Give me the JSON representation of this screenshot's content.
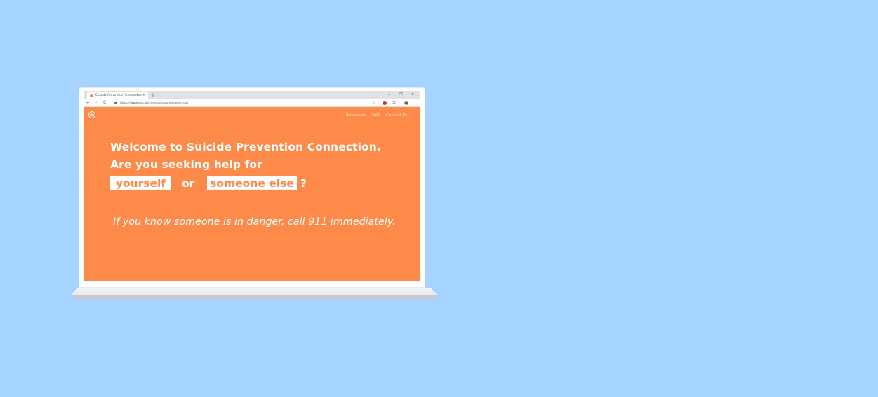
{
  "browser": {
    "tab_title": "Suicide Prevention Connection",
    "tab_close": "×",
    "new_tab": "+",
    "window_controls": {
      "minimize": "–",
      "restore": "❐",
      "close": "✕"
    },
    "nav": {
      "back": "←",
      "forward": "→",
      "reload": "C"
    },
    "url": "https://www.suicidepreventionconnection.com",
    "icons": {
      "star": "☆",
      "extension": "☰",
      "menu": "⋮"
    }
  },
  "site": {
    "nav": {
      "resources": "Resources",
      "faq": "FAQ",
      "contact": "Contact Us"
    },
    "headline_line1": "Welcome to Suicide Prevention Connection.",
    "headline_line2": "Are you seeking help for",
    "choice_yourself": "yourself",
    "connector_or": "or",
    "choice_someone_else": "someone else",
    "question_mark": "?",
    "danger_notice": "If you know someone is in danger, call 911 immediately."
  },
  "colors": {
    "background": "#a4d4ff",
    "brand_orange": "#fe8a49",
    "white": "#ffffff"
  }
}
